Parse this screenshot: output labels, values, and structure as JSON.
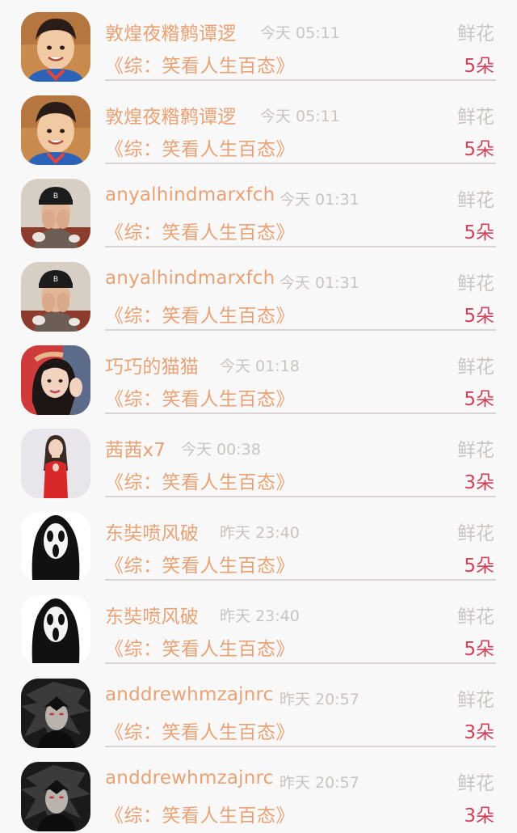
{
  "gift_list": {
    "items": [
      {
        "user": "敦煌夜糌鹩谭逻",
        "time": "今天 05:11",
        "gift": "鲜花",
        "book": "《综：笑看人生百态》",
        "amount": "5朵",
        "avatar_icon": "boy-avatar-icon"
      },
      {
        "user": "敦煌夜糌鹩谭逻",
        "time": "今天 05:11",
        "gift": "鲜花",
        "book": "《综：笑看人生百态》",
        "amount": "5朵",
        "avatar_icon": "boy-avatar-icon"
      },
      {
        "user": "anyalhindmarxfch",
        "time": "今天 01:31",
        "gift": "鲜花",
        "book": "《综：笑看人生百态》",
        "amount": "5朵",
        "avatar_icon": "cap-person-avatar-icon"
      },
      {
        "user": "anyalhindmarxfch",
        "time": "今天 01:31",
        "gift": "鲜花",
        "book": "《综：笑看人生百态》",
        "amount": "5朵",
        "avatar_icon": "cap-person-avatar-icon"
      },
      {
        "user": "巧巧的猫猫",
        "time": "今天 01:18",
        "gift": "鲜花",
        "book": "《综：笑看人生百态》",
        "amount": "5朵",
        "avatar_icon": "woman-avatar-icon"
      },
      {
        "user": "茜茜x7",
        "time": "今天 00:38",
        "gift": "鲜花",
        "book": "《综：笑看人生百态》",
        "amount": "3朵",
        "avatar_icon": "woman-red-dress-avatar-icon"
      },
      {
        "user": "东奘喷风破",
        "time": "昨天 23:40",
        "gift": "鲜花",
        "book": "《综：笑看人生百态》",
        "amount": "5朵",
        "avatar_icon": "ghost-mask-avatar-icon"
      },
      {
        "user": "东奘喷风破",
        "time": "昨天 23:40",
        "gift": "鲜花",
        "book": "《综：笑看人生百态》",
        "amount": "5朵",
        "avatar_icon": "ghost-mask-avatar-icon"
      },
      {
        "user": "anddrewhmzajnrc",
        "time": "昨天 20:57",
        "gift": "鲜花",
        "book": "《综：笑看人生百态》",
        "amount": "3朵",
        "avatar_icon": "dark-anime-avatar-icon"
      },
      {
        "user": "anddrewhmzajnrc",
        "time": "昨天 20:57",
        "gift": "鲜花",
        "book": "《综：笑看人生百态》",
        "amount": "3朵",
        "avatar_icon": "dark-anime-avatar-icon"
      }
    ]
  },
  "colors": {
    "name": "#e8a275",
    "muted": "#c9c4c2",
    "amount": "#d2415a",
    "divider": "#d9d6d5",
    "background": "#f9f8f8"
  }
}
